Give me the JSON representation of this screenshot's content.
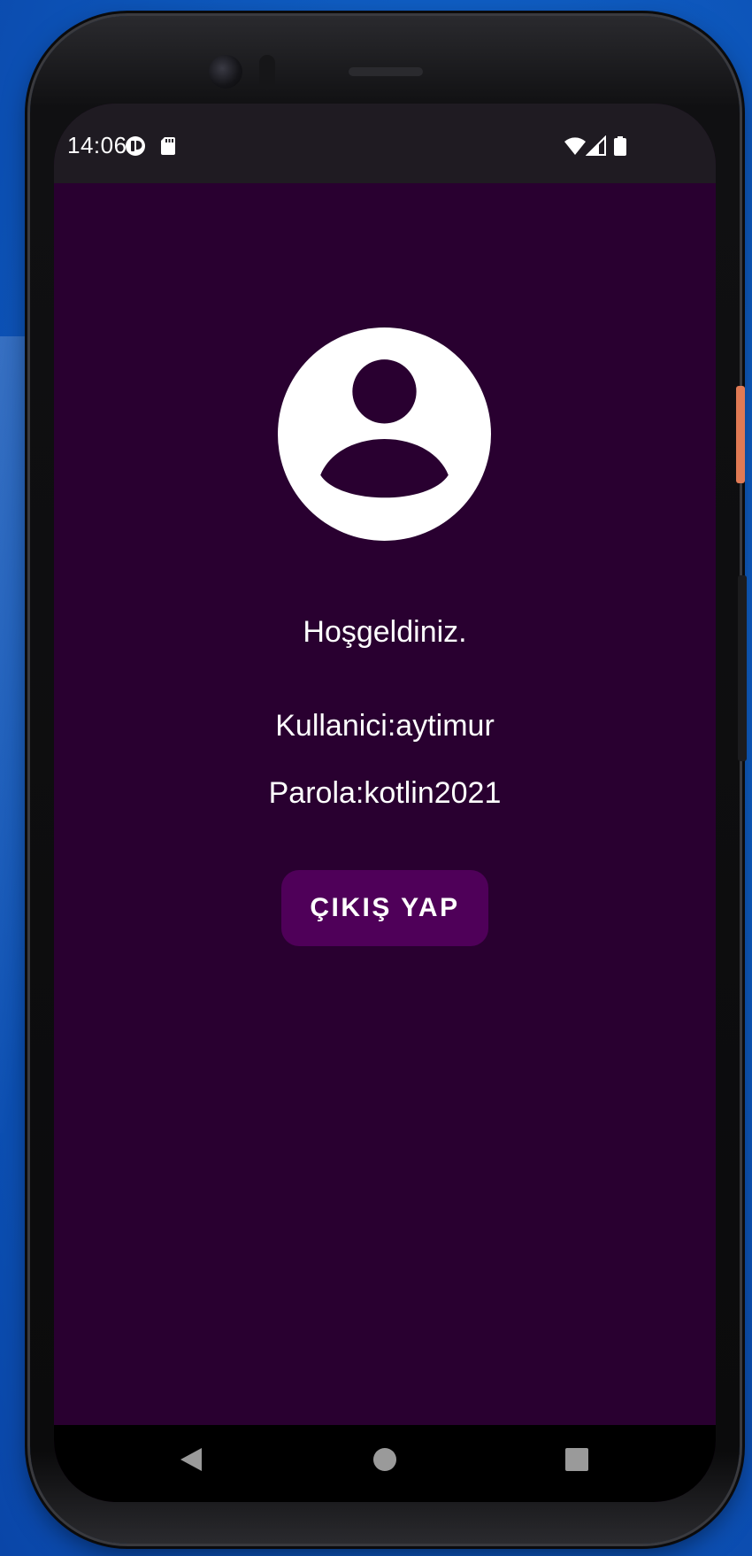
{
  "status_bar": {
    "time": "14:06",
    "icons": [
      "app-notification-icon",
      "sd-card-icon",
      "wifi-icon",
      "signal-icon",
      "battery-icon"
    ]
  },
  "profile": {
    "avatar_icon": "account-circle-icon",
    "welcome_text": "Hoşgeldiniz.",
    "username_line": "Kullanici:aytimur",
    "password_line": "Parola:kotlin2021"
  },
  "actions": {
    "logout_label": "ÇIKIŞ YAP"
  },
  "navigation": {
    "buttons": [
      "back-icon",
      "home-icon",
      "recents-icon"
    ]
  },
  "colors": {
    "screen_background": "#290030",
    "status_bar": "#1f1b22",
    "button": "#4f0059",
    "text": "#ffffff"
  }
}
